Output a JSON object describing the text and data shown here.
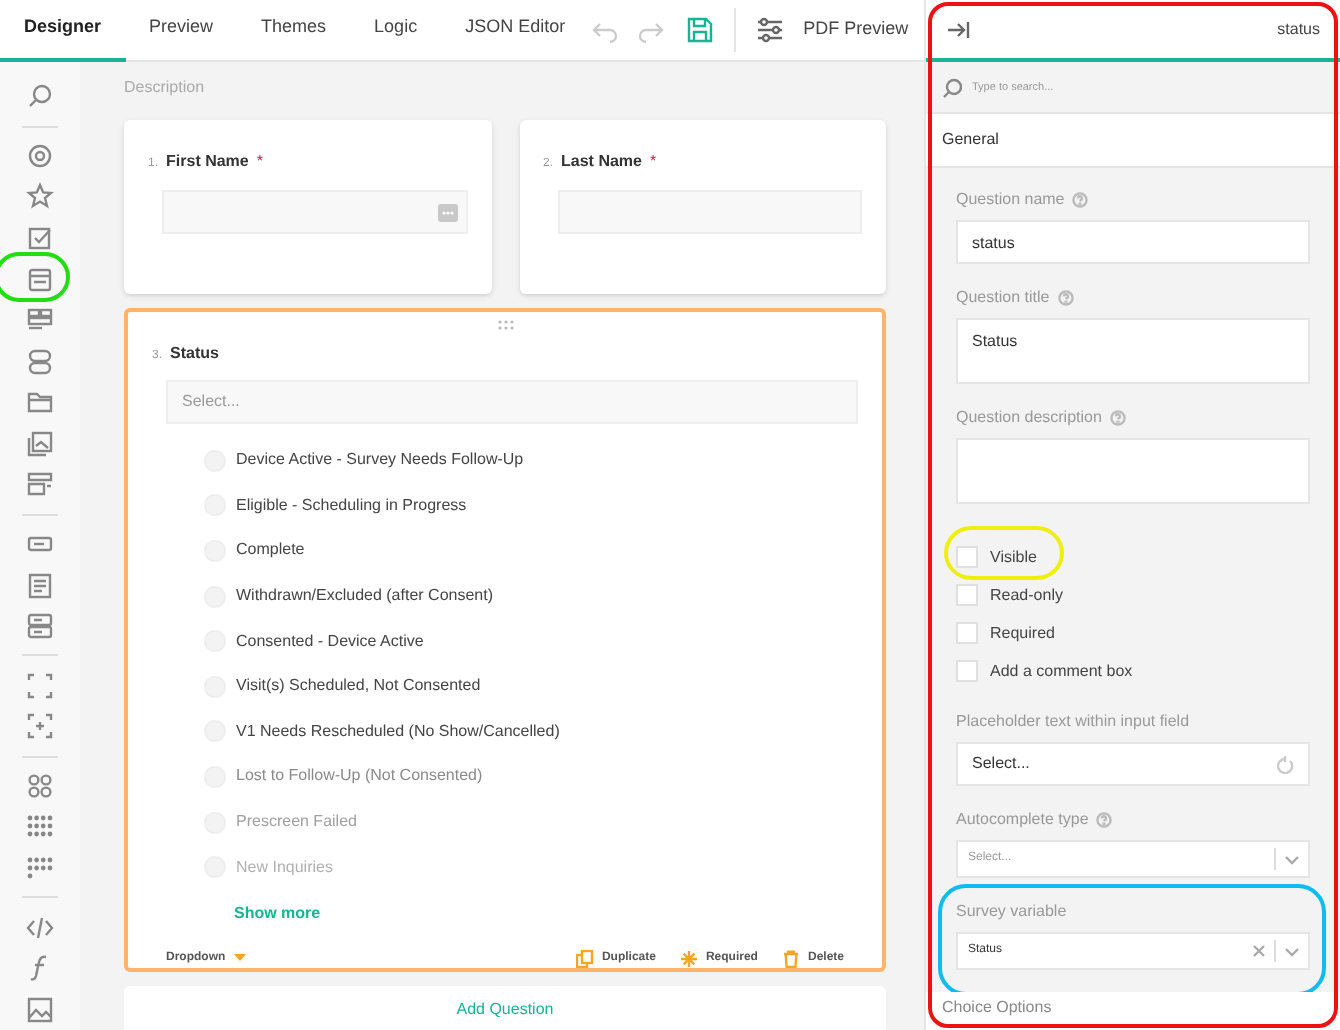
{
  "tabs": [
    {
      "label": "Designer",
      "selected": true
    },
    {
      "label": "Preview",
      "selected": false
    },
    {
      "label": "Themes",
      "selected": false
    },
    {
      "label": "Logic",
      "selected": false
    },
    {
      "label": "JSON Editor",
      "selected": false
    }
  ],
  "toolbar": {
    "undo_disabled": true,
    "redo_disabled": true,
    "pdf_preview": "PDF Preview"
  },
  "toolbox_groups": [
    [
      {
        "kind": "search"
      }
    ],
    [
      {
        "kind": "radio"
      },
      {
        "kind": "star"
      },
      {
        "kind": "checkbox"
      },
      {
        "kind": "dropdown",
        "color": "#22dd11"
      },
      {
        "kind": "tagbox"
      },
      {
        "kind": "boolean"
      },
      {
        "kind": "folder"
      },
      {
        "kind": "image-picker"
      },
      {
        "kind": "ranking"
      }
    ],
    [
      {
        "kind": "text"
      },
      {
        "kind": "comment"
      },
      {
        "kind": "multitext"
      }
    ],
    [
      {
        "kind": "panel"
      },
      {
        "kind": "dynamic-panel"
      }
    ],
    [
      {
        "kind": "matrix"
      },
      {
        "kind": "matrix-grid"
      },
      {
        "kind": "matrix-dynamic"
      }
    ],
    [
      {
        "kind": "html"
      },
      {
        "kind": "expression"
      },
      {
        "kind": "image"
      }
    ]
  ],
  "page": {
    "description": "Description"
  },
  "questions": [
    {
      "number": "1.",
      "title": "First Name",
      "required_mark": "*",
      "kind": "text-field",
      "has_menu_button": true
    },
    {
      "number": "2.",
      "title": "Last Name",
      "required_mark": "*",
      "kind": "text-field",
      "has_menu_button": false
    },
    {
      "number": "3.",
      "title": "Status",
      "kind": "dropdown",
      "selected": true,
      "placeholder": "Select...",
      "choices": [
        {
          "label": "Device Active - Survey Needs Follow-Up"
        },
        {
          "label": "Eligible - Scheduling in Progress"
        },
        {
          "label": "Complete"
        },
        {
          "label": "Withdrawn/Excluded (after Consent)"
        },
        {
          "label": "Consented - Device Active"
        },
        {
          "label": "Visit(s) Scheduled, Not Consented"
        },
        {
          "label": "V1 Needs Rescheduled (No Show/Cancelled)"
        },
        {
          "label": "Lost to Follow-Up (Not Consented)"
        },
        {
          "label": "Prescreen Failed"
        },
        {
          "label": "New Inquiries"
        }
      ],
      "show_more": "Show more",
      "type_label": "Dropdown",
      "actions": [
        {
          "kind": "duplicate",
          "label": "Duplicate"
        },
        {
          "kind": "required",
          "label": "Required"
        },
        {
          "kind": "delete",
          "label": "Delete"
        }
      ]
    }
  ],
  "add_question": "Add Question",
  "properties": {
    "color": "#ee1111",
    "title": "status",
    "search_placeholder": "Type to search...",
    "section": "General",
    "fields": [
      {
        "kind": "input",
        "label": "Question name",
        "help": true,
        "value": "status"
      },
      {
        "kind": "textarea",
        "label": "Question title",
        "help": true,
        "value": "Status"
      },
      {
        "kind": "textarea",
        "label": "Question description",
        "help": true
      },
      {
        "kind": "checkbox",
        "label": "Visible",
        "checked": false,
        "color": "#eeee11"
      },
      {
        "kind": "checkbox",
        "label": "Read-only",
        "checked": false
      },
      {
        "kind": "checkbox",
        "label": "Required",
        "checked": false
      },
      {
        "kind": "checkbox",
        "label": "Add a comment box",
        "checked": false
      },
      {
        "kind": "localized",
        "label": "Placeholder text within input field",
        "help": false,
        "value": "Select..."
      },
      {
        "kind": "select",
        "label": "Autocomplete type",
        "help": true,
        "placeholder": "Select...",
        "clearable": false
      },
      {
        "kind": "select",
        "label": "Survey variable",
        "help": false,
        "value": "Status",
        "clearable": true,
        "color": "#11bbee"
      }
    ],
    "next_section": "Choice Options"
  }
}
